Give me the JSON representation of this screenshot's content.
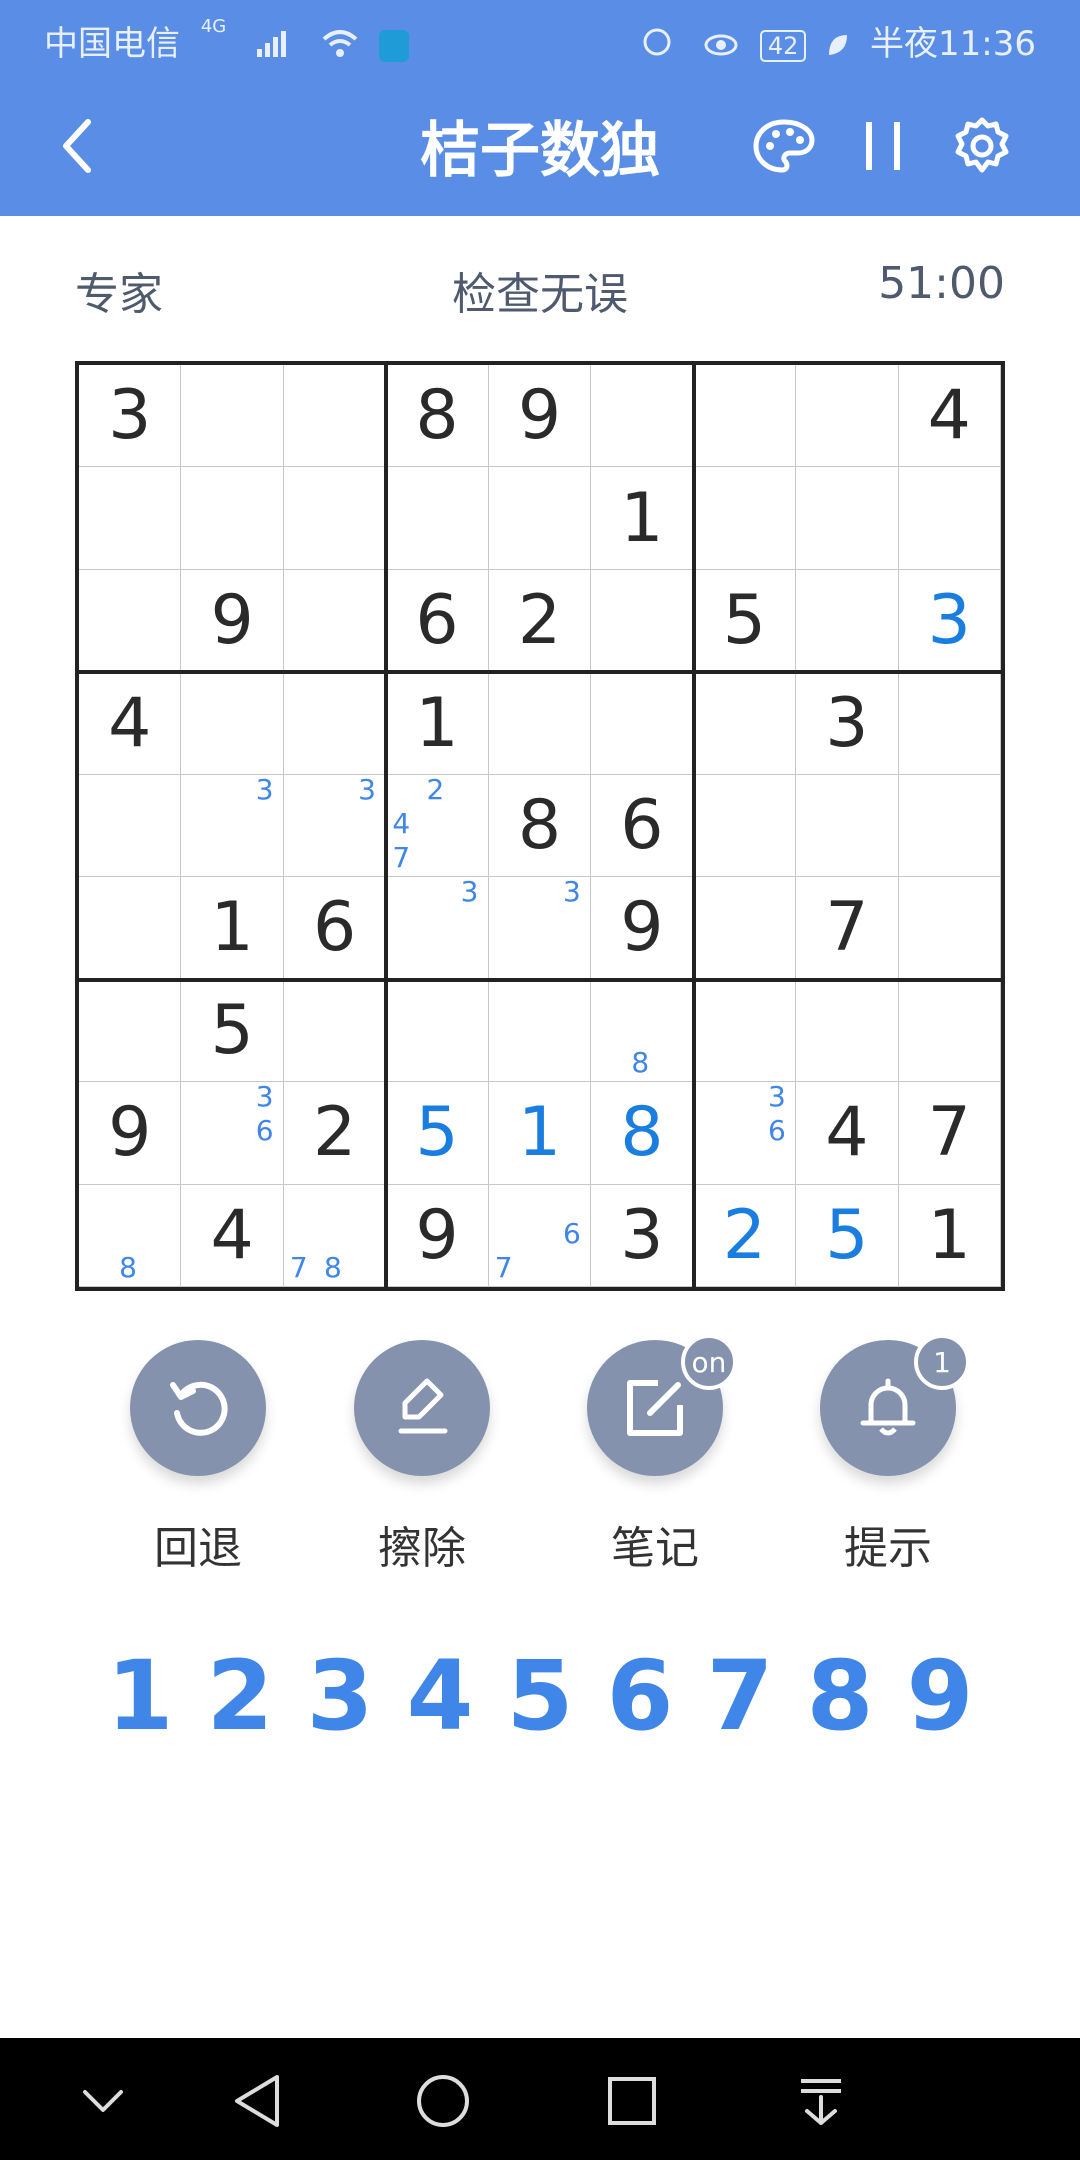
{
  "status_bar": {
    "carrier": "中国电信",
    "network": "4G",
    "battery": "42",
    "time": "半夜11:36"
  },
  "app": {
    "title": "桔子数独",
    "difficulty": "专家",
    "check_status": "检查无误",
    "timer": "51:00"
  },
  "grid": [
    [
      3,
      0,
      0,
      8,
      9,
      0,
      0,
      0,
      4
    ],
    [
      0,
      0,
      0,
      0,
      0,
      1,
      0,
      0,
      0
    ],
    [
      0,
      9,
      0,
      6,
      2,
      0,
      5,
      0,
      3
    ],
    [
      4,
      0,
      0,
      1,
      0,
      0,
      0,
      3,
      0
    ],
    [
      0,
      0,
      0,
      0,
      8,
      6,
      0,
      0,
      0
    ],
    [
      0,
      1,
      6,
      0,
      0,
      9,
      0,
      7,
      0
    ],
    [
      0,
      5,
      0,
      0,
      0,
      0,
      0,
      0,
      0
    ],
    [
      9,
      0,
      2,
      5,
      1,
      8,
      0,
      4,
      7
    ],
    [
      0,
      4,
      0,
      9,
      0,
      3,
      2,
      5,
      1
    ]
  ],
  "user_cells": [
    [
      2,
      8
    ],
    [
      7,
      3
    ],
    [
      7,
      4
    ],
    [
      7,
      5
    ],
    [
      8,
      6
    ],
    [
      8,
      7
    ]
  ],
  "notes": [
    {
      "r": 4,
      "c": 1,
      "text": "3"
    },
    {
      "r": 4,
      "c": 2,
      "text": "3"
    },
    {
      "r": 4,
      "c": 3,
      "text": "2"
    },
    {
      "r": 4,
      "c": 3,
      "text": "4"
    },
    {
      "r": 4,
      "c": 3,
      "text": "7"
    },
    {
      "r": 5,
      "c": 3,
      "text": "3"
    },
    {
      "r": 5,
      "c": 4,
      "text": "3"
    },
    {
      "r": 6,
      "c": 5,
      "text": "8"
    },
    {
      "r": 7,
      "c": 1,
      "text": "3"
    },
    {
      "r": 7,
      "c": 1,
      "text": "6"
    },
    {
      "r": 7,
      "c": 6,
      "text": "3"
    },
    {
      "r": 7,
      "c": 6,
      "text": "6"
    },
    {
      "r": 8,
      "c": 0,
      "text": "8"
    },
    {
      "r": 8,
      "c": 2,
      "text": "7"
    },
    {
      "r": 8,
      "c": 2,
      "text": "8"
    },
    {
      "r": 8,
      "c": 4,
      "text": "7"
    },
    {
      "r": 8,
      "c": 4,
      "text": "6"
    }
  ],
  "tools": {
    "undo": "回退",
    "erase": "擦除",
    "notes": "笔记",
    "notes_badge": "on",
    "hint": "提示",
    "hint_badge": "1"
  },
  "numpad": [
    "1",
    "2",
    "3",
    "4",
    "5",
    "6",
    "7",
    "8",
    "9"
  ],
  "colors": {
    "accent": "#5a8ee6",
    "user_digit": "#1a7de0",
    "note": "#3f86e8",
    "given_digit": "#2a2a2a",
    "tool_bg": "#8592ad"
  }
}
